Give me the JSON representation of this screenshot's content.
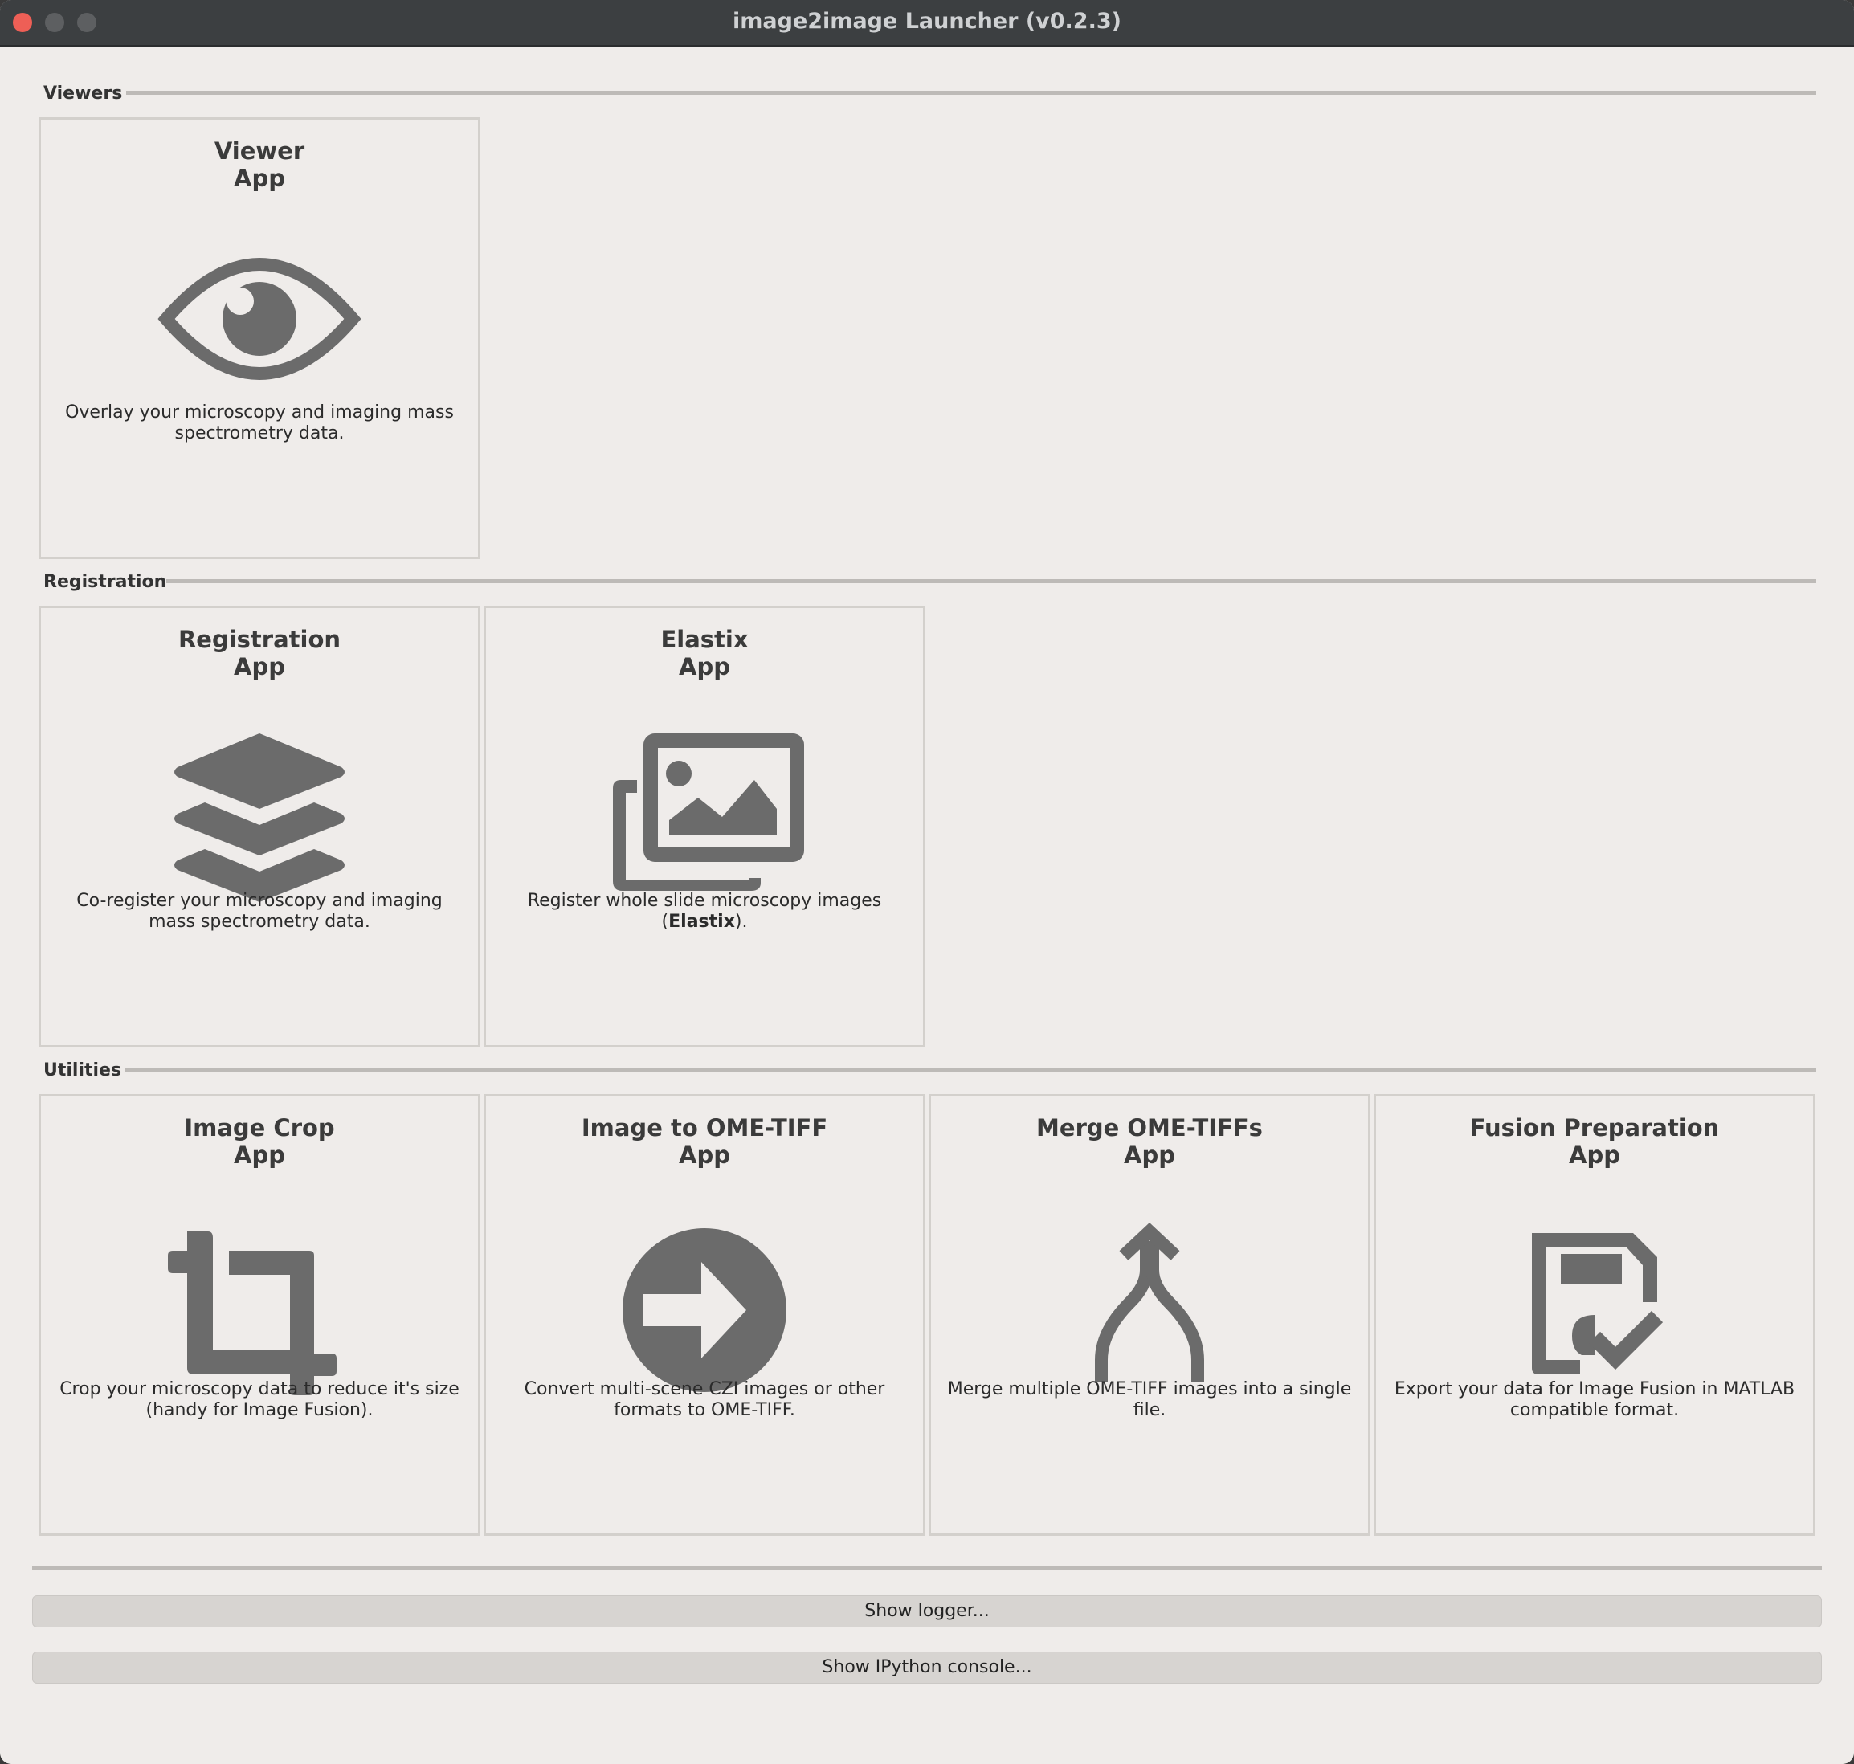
{
  "window": {
    "title": "image2image Launcher (v0.2.3)"
  },
  "sections": [
    {
      "label": "Viewers"
    },
    {
      "label": "Registration"
    },
    {
      "label": "Utilities"
    }
  ],
  "apps": {
    "viewer": {
      "title": "Viewer",
      "subtitle": "App",
      "icon": "eye-icon",
      "desc": "Overlay your microscopy and imaging mass spectrometry data."
    },
    "registration": {
      "title": "Registration",
      "subtitle": "App",
      "icon": "layers-icon",
      "desc": "Co-register your microscopy and imaging mass spectrometry data."
    },
    "elastix": {
      "title": "Elastix",
      "subtitle": "App",
      "icon": "images-icon",
      "desc_prefix": "Register whole slide microscopy images (",
      "desc_bold": "Elastix",
      "desc_suffix": ")."
    },
    "crop": {
      "title": "Image Crop",
      "subtitle": "App",
      "icon": "crop-icon",
      "desc": "Crop your microscopy data to reduce it's size (handy for Image Fusion)."
    },
    "convert": {
      "title": "Image to OME-TIFF",
      "subtitle": "App",
      "icon": "arrow-circle-icon",
      "desc": "Convert multi-scene CZI images or other formats to OME-TIFF."
    },
    "merge": {
      "title": "Merge OME-TIFFs",
      "subtitle": "App",
      "icon": "merge-icon",
      "desc": "Merge multiple OME-TIFF images into a single file."
    },
    "fusion": {
      "title": "Fusion Preparation",
      "subtitle": "App",
      "icon": "save-check-icon",
      "desc": "Export your data for Image Fusion in MATLAB compatible format."
    }
  },
  "buttons": {
    "logger": "Show logger...",
    "console": "Show IPython console..."
  },
  "colors": {
    "icon": "#6b6b6b",
    "background": "#efecea",
    "titlebar": "#3c3f41"
  }
}
